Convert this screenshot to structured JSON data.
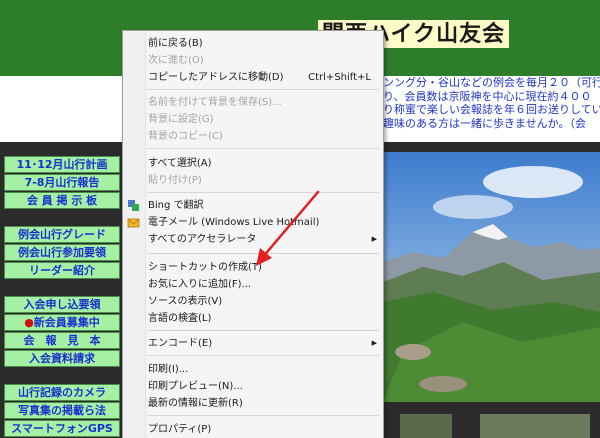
{
  "site": {
    "title": "関西ハイク山友会",
    "intro_lines": [
      "ンング分・谷山などの例会を毎月２０（可行ー",
      "り、会員数は京阪神を中心に現在約４００",
      "り称蜜で楽しい会報誌を年６回お送りしてい",
      "趣味のある方は一緒に歩きませんか。（会"
    ]
  },
  "sidebar": {
    "items": [
      {
        "label": "11･12月山行計画"
      },
      {
        "label": "7-8月山行報告"
      },
      {
        "label": "会 員 掲 示 板"
      },
      {
        "label": "例会山行グレード"
      },
      {
        "label": "例会山行参加要領"
      },
      {
        "label": "リーダー紹介"
      },
      {
        "label": "入会申し込要領"
      },
      {
        "label": "新会員募集中",
        "marker": "●"
      },
      {
        "label": "会　報　見　本"
      },
      {
        "label": "入会資料請求"
      },
      {
        "label": "山行記録のカメラ"
      },
      {
        "label": "写真集の掲載ら法"
      },
      {
        "label": "スマートフォンGPS"
      }
    ]
  },
  "context_menu": {
    "items": [
      {
        "label": "前に戻る(B)",
        "shortcut": "",
        "disabled": false
      },
      {
        "label": "次に進む(O)",
        "shortcut": "",
        "disabled": true
      },
      {
        "label": "コピーしたアドレスに移動(D)",
        "shortcut": "Ctrl+Shift+L",
        "disabled": false
      },
      {
        "label": "名前を付けて背景を保存(S)...",
        "shortcut": "",
        "disabled": true
      },
      {
        "label": "背景に設定(G)",
        "shortcut": "",
        "disabled": true
      },
      {
        "label": "背景のコピー(C)",
        "shortcut": "",
        "disabled": true
      },
      {
        "label": "すべて選択(A)",
        "shortcut": "",
        "disabled": false
      },
      {
        "label": "貼り付け(P)",
        "shortcut": "",
        "disabled": true
      },
      {
        "label": "Bing で翻訳",
        "shortcut": "",
        "disabled": false,
        "icon": "bing-translate-icon"
      },
      {
        "label": "電子メール (Windows Live Hotmail)",
        "shortcut": "",
        "disabled": false,
        "icon": "email-icon"
      },
      {
        "label": "すべてのアクセラレータ",
        "shortcut": "",
        "disabled": false,
        "submenu": true
      },
      {
        "label": "ショートカットの作成(T)",
        "shortcut": "",
        "disabled": false
      },
      {
        "label": "お気に入りに追加(F)...",
        "shortcut": "",
        "disabled": false
      },
      {
        "label": "ソースの表示(V)",
        "shortcut": "",
        "disabled": false
      },
      {
        "label": "言語の検査(L)",
        "shortcut": "",
        "disabled": false
      },
      {
        "label": "エンコード(E)",
        "shortcut": "",
        "disabled": false,
        "submenu": true
      },
      {
        "label": "印刷(I)...",
        "shortcut": "",
        "disabled": false
      },
      {
        "label": "印刷プレビュー(N)...",
        "shortcut": "",
        "disabled": false
      },
      {
        "label": "最新の情報に更新(R)",
        "shortcut": "",
        "disabled": false
      },
      {
        "label": "プロパティ(P)",
        "shortcut": "",
        "disabled": false
      }
    ]
  },
  "annotation": {
    "color": "#e02020"
  }
}
